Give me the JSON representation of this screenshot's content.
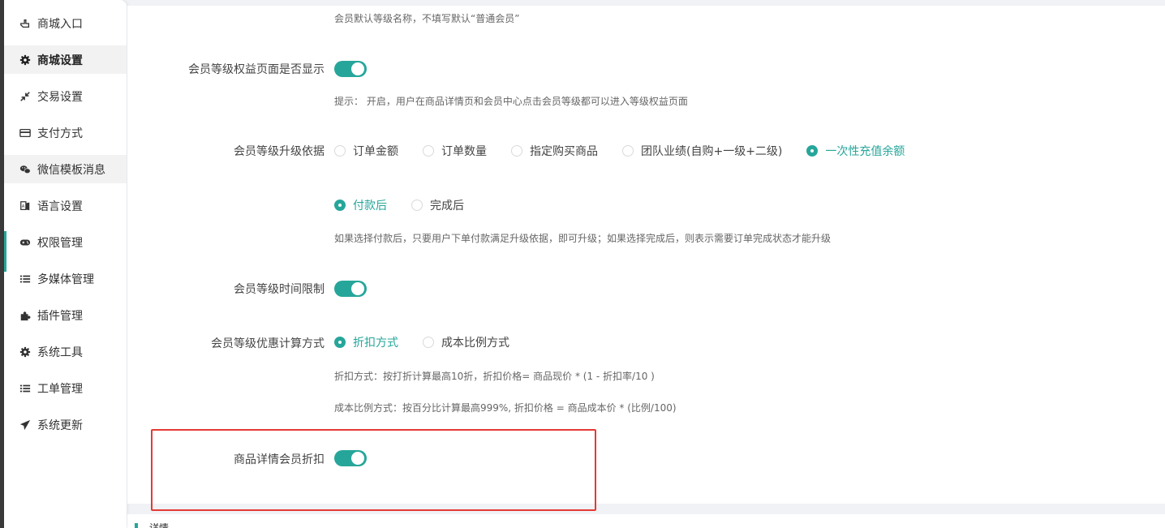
{
  "sidebar": {
    "items": [
      {
        "label": "商城入口",
        "icon": "hand-pointer-icon"
      },
      {
        "label": "商城设置",
        "icon": "gear-icon"
      },
      {
        "label": "交易设置",
        "icon": "compress-arrows-icon"
      },
      {
        "label": "支付方式",
        "icon": "credit-card-icon"
      },
      {
        "label": "微信模板消息",
        "icon": "wechat-icon"
      },
      {
        "label": "语言设置",
        "icon": "language-book-icon"
      },
      {
        "label": "权限管理",
        "icon": "gamepad-icon"
      },
      {
        "label": "多媒体管理",
        "icon": "list-icon"
      },
      {
        "label": "插件管理",
        "icon": "puzzle-icon"
      },
      {
        "label": "系统工具",
        "icon": "gear-icon"
      },
      {
        "label": "工单管理",
        "icon": "list-icon"
      },
      {
        "label": "系统更新",
        "icon": "paper-plane-icon"
      }
    ]
  },
  "form": {
    "level_name_hint": "会员默认等级名称，不填写默认“普通会员”",
    "rights_page": {
      "label": "会员等级权益页面是否显示",
      "enabled": true,
      "hint": "提示： 开启，用户在商品详情页和会员中心点击会员等级都可以进入等级权益页面"
    },
    "upgrade_basis": {
      "label": "会员等级升级依据",
      "options": [
        "订单金额",
        "订单数量",
        "指定购买商品",
        "团队业绩(自购+一级+二级)",
        "一次性充值余额"
      ],
      "selected": "一次性充值余额"
    },
    "upgrade_timing": {
      "options": [
        "付款后",
        "完成后"
      ],
      "selected": "付款后",
      "hint": "如果选择付款后，只要用户下单付款满足升级依据，即可升级；如果选择完成后，则表示需要订单完成状态才能升级"
    },
    "time_limit": {
      "label": "会员等级时间限制",
      "enabled": true
    },
    "discount_method": {
      "label": "会员等级优惠计算方式",
      "options": [
        "折扣方式",
        "成本比例方式"
      ],
      "selected": "折扣方式",
      "hint1": "折扣方式：按打折计算最高10折，折扣价格= 商品现价 * (1 - 折扣率/10 )",
      "hint2": "成本比例方式：按百分比计算最高999%, 折扣价格 = 商品成本价 * (比例/100)"
    },
    "detail_discount": {
      "label": "商品详情会员折扣",
      "enabled": true
    }
  },
  "bottom_section": {
    "title": "详情"
  },
  "colors": {
    "accent": "#26a69a",
    "highlight_border": "#e53935"
  }
}
